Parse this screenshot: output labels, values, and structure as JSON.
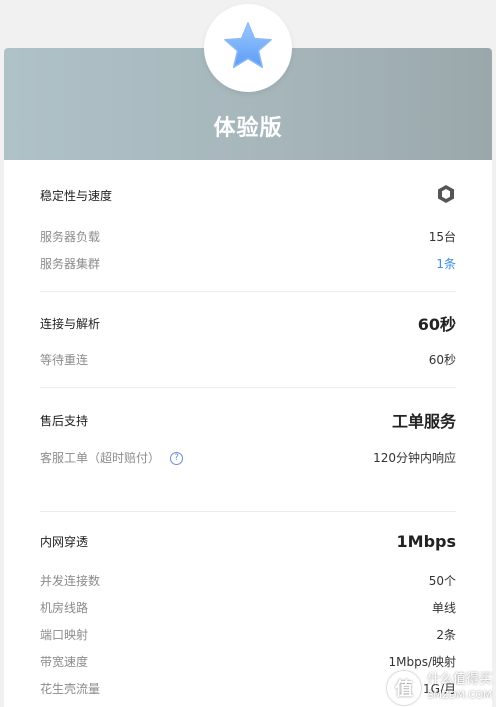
{
  "plan": {
    "title": "体验版",
    "icon": "star-icon",
    "colors": {
      "banner_start": "#afc2c8",
      "banner_end": "#9aa8ab",
      "link_blue": "#3a8ee6",
      "star_blue": "#6aa8ff"
    }
  },
  "stability": {
    "title": "稳定性与速度",
    "badge_icon": "hexagon-badge-icon",
    "rows": [
      {
        "label": "服务器负载",
        "value": "15台"
      },
      {
        "label": "服务器集群",
        "value": "1条"
      }
    ]
  },
  "connection": {
    "title": "连接与解析",
    "headline": "60秒",
    "rows": [
      {
        "label": "等待重连",
        "value": "60秒"
      }
    ]
  },
  "support": {
    "title": "售后支持",
    "headline": "工单服务",
    "rows": [
      {
        "label": "客服工单（超时赔付）",
        "value": "120分钟内响应",
        "help_icon": "question-circle-icon"
      }
    ]
  },
  "intranet": {
    "title": "内网穿透",
    "headline": "1Mbps",
    "rows": [
      {
        "label": "并发连接数",
        "value": "50个"
      },
      {
        "label": "机房线路",
        "value": "单线"
      },
      {
        "label": "端口映射",
        "value": "2条"
      },
      {
        "label": "带宽速度",
        "value": "1Mbps/映射"
      },
      {
        "label": "花生壳流量",
        "value": "1G/月"
      }
    ]
  },
  "watermark": {
    "symbol": "值",
    "line1": "什么值得买",
    "line2": "SMZDM.COM"
  }
}
